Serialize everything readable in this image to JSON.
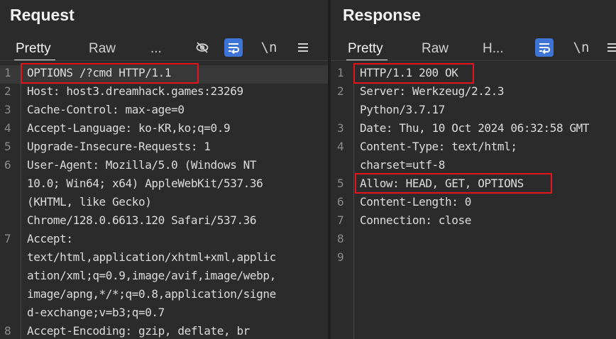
{
  "request": {
    "title": "Request",
    "tabs": [
      {
        "label": "Pretty",
        "active": true
      },
      {
        "label": "Raw",
        "active": false
      },
      {
        "label": "...",
        "active": false
      }
    ],
    "toolbar": {
      "hide_icon": "eye-slash-icon",
      "wrap_icon": "wrap-lines-icon",
      "newline_label": "\\n",
      "menu_icon": "hamburger-icon"
    },
    "lines": [
      {
        "num": "1",
        "text": "OPTIONS /?cmd HTTP/1.1"
      },
      {
        "num": "2",
        "text": "Host: host3.dreamhack.games:23269"
      },
      {
        "num": "3",
        "text": "Cache-Control: max-age=0"
      },
      {
        "num": "4",
        "text": "Accept-Language: ko-KR,ko;q=0.9"
      },
      {
        "num": "5",
        "text": "Upgrade-Insecure-Requests: 1"
      },
      {
        "num": "6",
        "text": "User-Agent: Mozilla/5.0 (Windows NT"
      },
      {
        "num": "",
        "text": "10.0; Win64; x64) AppleWebKit/537.36"
      },
      {
        "num": "",
        "text": "(KHTML, like Gecko)"
      },
      {
        "num": "",
        "text": "Chrome/128.0.6613.120 Safari/537.36"
      },
      {
        "num": "7",
        "text": "Accept:"
      },
      {
        "num": "",
        "text": "text/html,application/xhtml+xml,applic"
      },
      {
        "num": "",
        "text": "ation/xml;q=0.9,image/avif,image/webp,"
      },
      {
        "num": "",
        "text": "image/apng,*/*;q=0.8,application/signe"
      },
      {
        "num": "",
        "text": "d-exchange;v=b3;q=0.7"
      },
      {
        "num": "8",
        "text": "Accept-Encoding: gzip, deflate, br"
      }
    ]
  },
  "response": {
    "title": "Response",
    "tabs": [
      {
        "label": "Pretty",
        "active": true
      },
      {
        "label": "Raw",
        "active": false
      },
      {
        "label": "H...",
        "active": false
      }
    ],
    "toolbar": {
      "wrap_icon": "wrap-lines-icon",
      "newline_label": "\\n",
      "menu_icon": "hamburger-icon"
    },
    "lines": [
      {
        "num": "1",
        "text": "HTTP/1.1 200 OK"
      },
      {
        "num": "2",
        "text": "Server: Werkzeug/2.2.3"
      },
      {
        "num": "",
        "text": "Python/3.7.17"
      },
      {
        "num": "3",
        "text": "Date: Thu, 10 Oct 2024 06:32:58 GMT"
      },
      {
        "num": "4",
        "text": "Content-Type: text/html;"
      },
      {
        "num": "",
        "text": "charset=utf-8"
      },
      {
        "num": "5",
        "text": "Allow: HEAD, GET, OPTIONS"
      },
      {
        "num": "6",
        "text": "Content-Length: 0"
      },
      {
        "num": "7",
        "text": "Connection: close"
      },
      {
        "num": "8",
        "text": ""
      },
      {
        "num": "9",
        "text": ""
      }
    ]
  },
  "colors": {
    "background": "#2b2b2b",
    "accent_blue": "#3d74d6",
    "annotation_red": "#e5141c"
  }
}
